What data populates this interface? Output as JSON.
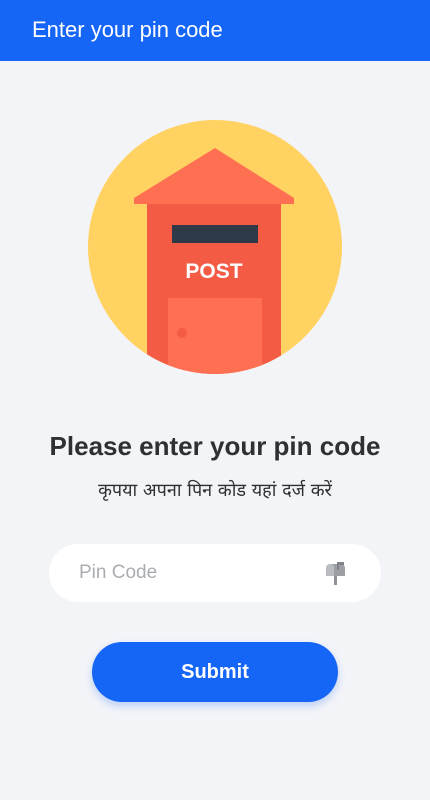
{
  "app_bar": {
    "title": "Enter your pin code"
  },
  "illustration": {
    "icon": "post-box-icon",
    "sign_text": "POST"
  },
  "content": {
    "heading": "Please enter your pin code",
    "subheading": "कृपया अपना पिन कोड यहां दर्ज करें"
  },
  "pin_input": {
    "value": "",
    "placeholder": "Pin Code",
    "icon": "mailbox-icon"
  },
  "submit": {
    "label": "Submit"
  },
  "colors": {
    "primary": "#1565f7",
    "background": "#f3f4f8",
    "circle": "#ffd261",
    "postbox": "#f45b44",
    "postbox_light": "#ff6f52",
    "slot": "#2f3a48"
  }
}
